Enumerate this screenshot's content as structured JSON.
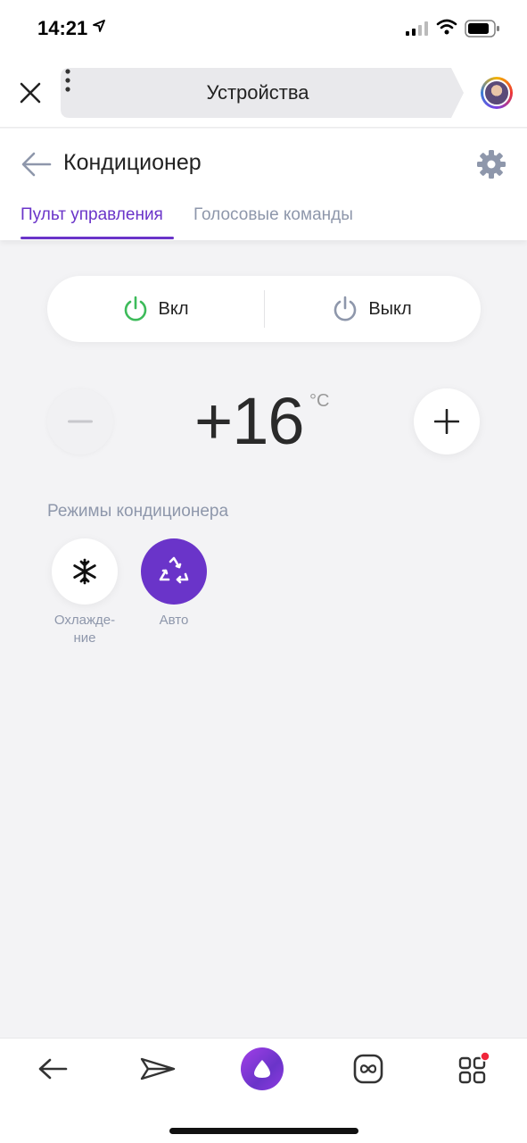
{
  "status_bar": {
    "time": "14:21"
  },
  "browser": {
    "title": "Устройства"
  },
  "page": {
    "title": "Кондиционер",
    "tabs": [
      {
        "label": "Пульт управления",
        "active": true
      },
      {
        "label": "Голосовые команды",
        "active": false
      }
    ]
  },
  "power": {
    "on_label": "Вкл",
    "off_label": "Выкл"
  },
  "temperature": {
    "value": "+16",
    "unit": "°C"
  },
  "modes": {
    "heading": "Режимы кондиционера",
    "items": [
      {
        "label": "Охлажде-\nние",
        "icon": "snowflake-icon",
        "active": false
      },
      {
        "label": "Авто",
        "icon": "auto-cycle-icon",
        "active": true
      }
    ]
  },
  "colors": {
    "accent": "#6a34c9",
    "power_on": "#3dbb5a",
    "muted_text": "#8e97ab"
  },
  "bottom_nav": {
    "items": [
      "back-icon",
      "send-icon",
      "alice-icon",
      "loop-icon",
      "apps-icon"
    ]
  }
}
